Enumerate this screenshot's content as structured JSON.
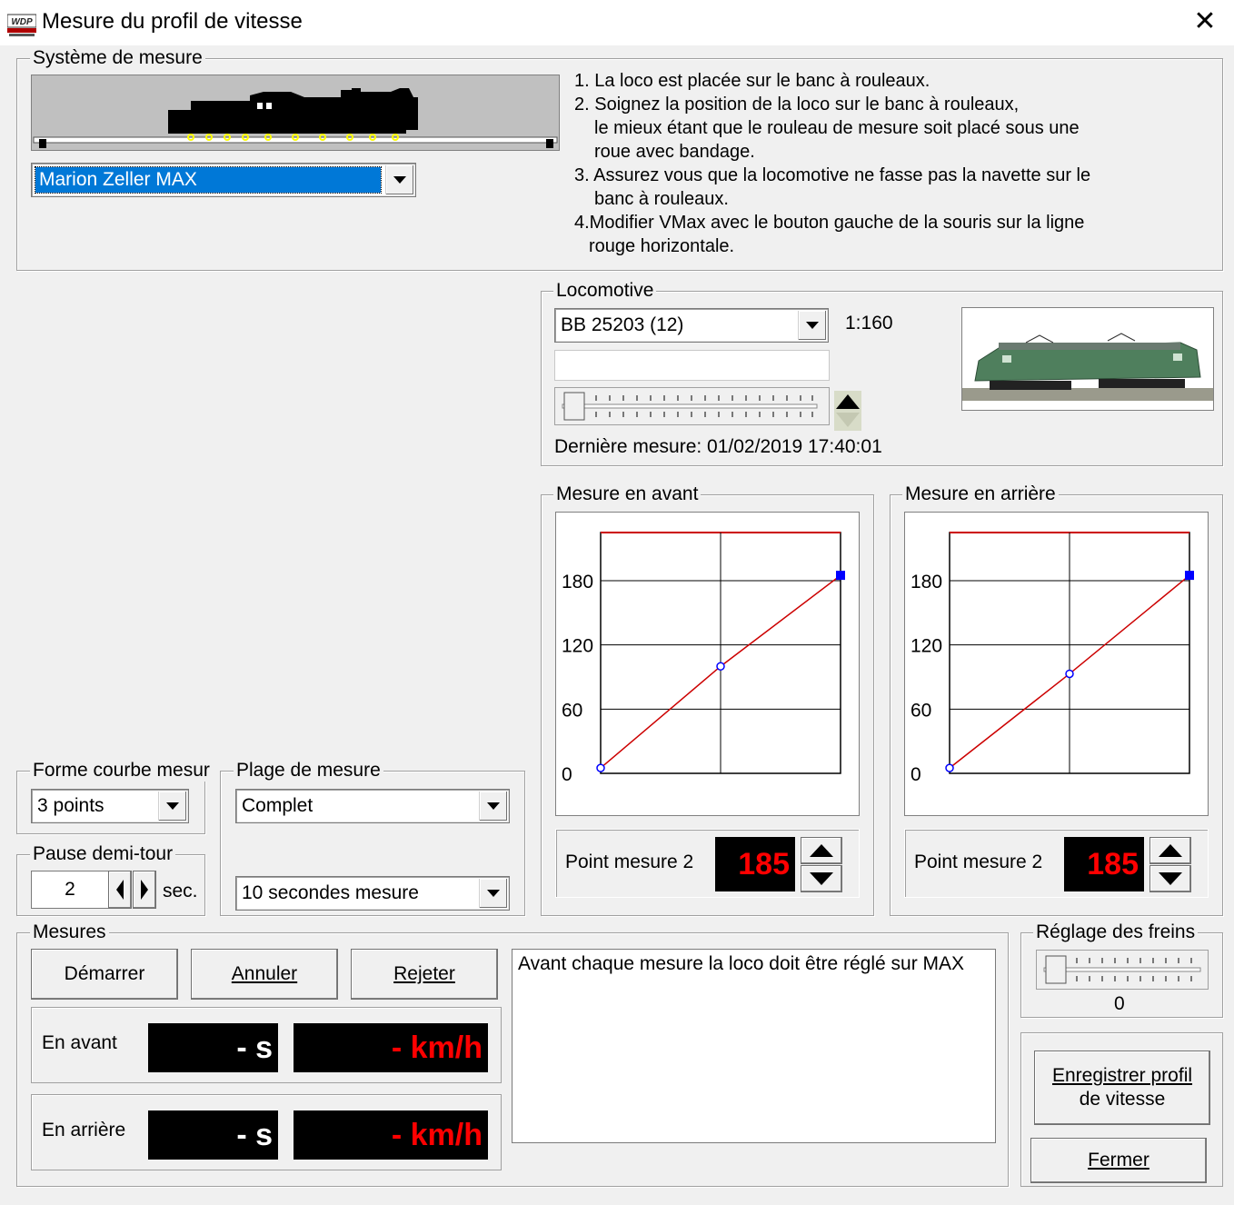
{
  "window": {
    "title": "Mesure du profil de vitesse",
    "logo_text": "WDP"
  },
  "systeme": {
    "label": "Système de mesure",
    "selected": "Marion Zeller MAX",
    "instructions": [
      "1. La loco est placée sur le banc à rouleaux.",
      "2. Soignez la position de la loco sur le banc à rouleaux,",
      "le mieux étant que le rouleau de mesure soit placé sous une",
      "roue avec bandage.",
      "3. Assurez vous que la locomotive ne fasse pas la navette sur le",
      "banc à rouleaux.",
      "4.Modifier VMax avec le bouton gauche de la souris sur la ligne",
      "rouge horizontale."
    ]
  },
  "locomotive": {
    "label": "Locomotive",
    "selected": "BB 25203 (12)",
    "scale": "1:160",
    "last_measure": "Dernière mesure: 01/02/2019 17:40:01"
  },
  "forward": {
    "label": "Mesure en avant",
    "point_label": "Point mesure 2",
    "point_value": "185",
    "y_ticks": [
      "180",
      "120",
      "60",
      "0"
    ]
  },
  "backward": {
    "label": "Mesure en arrière",
    "point_label": "Point mesure 2",
    "point_value": "185",
    "y_ticks": [
      "180",
      "120",
      "60",
      "0"
    ]
  },
  "forme": {
    "label": "Forme courbe mesur",
    "selected": "3 points"
  },
  "plage": {
    "label": "Plage de mesure",
    "selected": "Complet",
    "duration": "10 secondes mesure"
  },
  "pause": {
    "label": "Pause demi-tour",
    "value": "2",
    "unit": "sec."
  },
  "mesures": {
    "label": "Mesures",
    "start": "Démarrer",
    "cancel": "Annuler",
    "reject": "Rejeter",
    "forward_label": "En avant",
    "backward_label": "En arrière",
    "forward_time": "- s",
    "forward_speed": "- km/h",
    "backward_time": "- s",
    "backward_speed": "- km/h",
    "message": "Avant chaque mesure la loco doit être réglé sur MAX"
  },
  "freins": {
    "label": "Réglage des freins",
    "value": "0"
  },
  "actions": {
    "save_line1": "Enregistrer profil",
    "save_line2": "de vitesse",
    "close": "Fermer"
  },
  "chart_data": [
    {
      "type": "line",
      "title": "Mesure en avant",
      "x": [
        0,
        1,
        2
      ],
      "y": [
        5,
        100,
        185
      ],
      "ylim": [
        0,
        225
      ],
      "y_ticks": [
        0,
        60,
        120,
        180
      ],
      "vmax": 225,
      "grid": true
    },
    {
      "type": "line",
      "title": "Mesure en arrière",
      "x": [
        0,
        1,
        2
      ],
      "y": [
        5,
        93,
        185
      ],
      "ylim": [
        0,
        225
      ],
      "y_ticks": [
        0,
        60,
        120,
        180
      ],
      "vmax": 225,
      "grid": true
    }
  ],
  "colors": {
    "selection": "#0078d7",
    "curve": "#cc0000",
    "led_red": "#ff0000",
    "point_blue": "#0000ff"
  }
}
